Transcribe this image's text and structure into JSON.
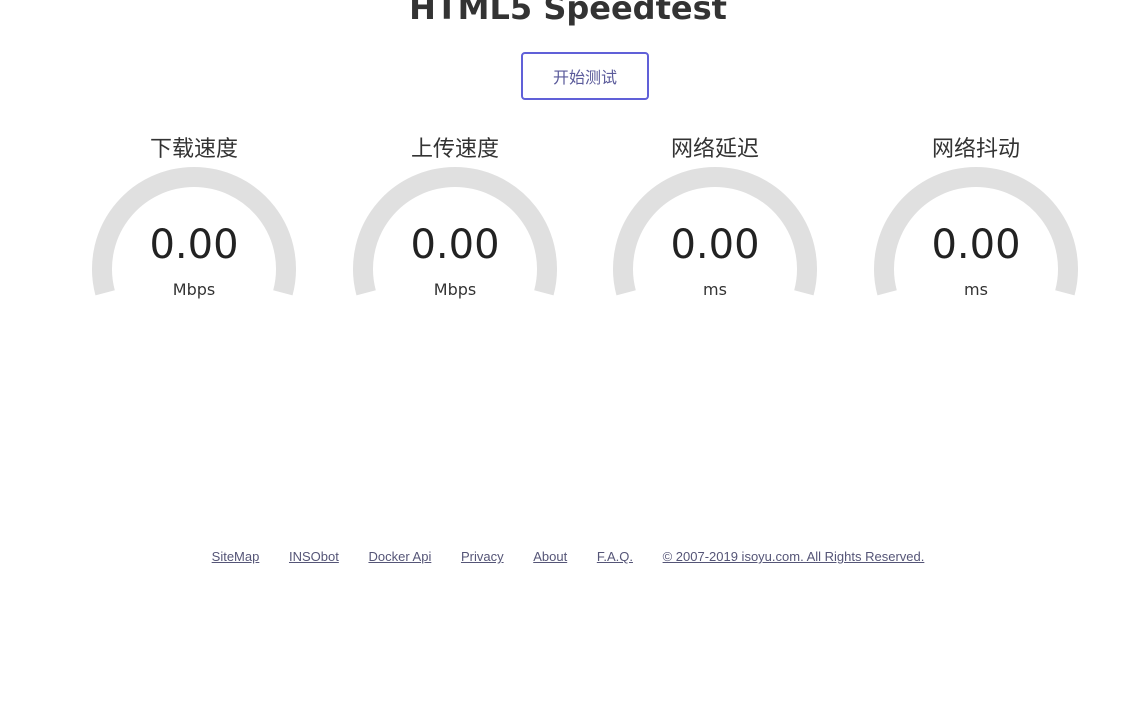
{
  "page": {
    "title": "HTML5 Speedtest"
  },
  "controls": {
    "start_label": "开始测试"
  },
  "meters": [
    {
      "label": "下载速度",
      "value": "0.00",
      "unit": "Mbps",
      "level": 0
    },
    {
      "label": "上传速度",
      "value": "0.00",
      "unit": "Mbps",
      "level": 0
    },
    {
      "label": "网络延迟",
      "value": "0.00",
      "unit": "ms",
      "level": 0
    },
    {
      "label": "网络抖动",
      "value": "0.00",
      "unit": "ms",
      "level": 0
    }
  ],
  "footer": {
    "links": [
      {
        "label": "SiteMap"
      },
      {
        "label": "INSObot"
      },
      {
        "label": "Docker Api"
      },
      {
        "label": "Privacy"
      },
      {
        "label": "About"
      },
      {
        "label": "F.A.Q."
      },
      {
        "label": "© 2007-2019 isoyu.com. All Rights Reserved."
      }
    ]
  },
  "colors": {
    "gauge_track": "#e0e0e0",
    "button_border": "#6060d8",
    "link": "#555577"
  }
}
